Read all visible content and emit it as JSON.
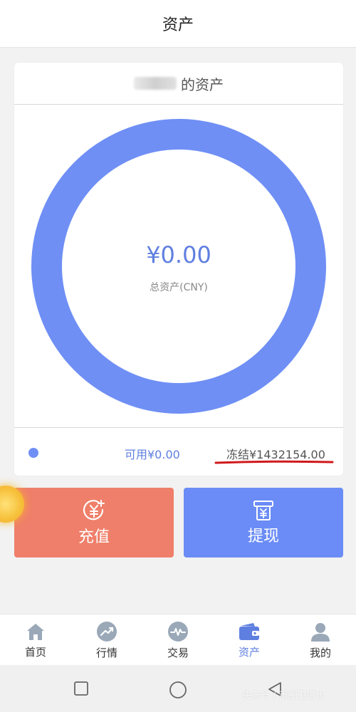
{
  "header": {
    "title": "资产"
  },
  "card": {
    "owner_suffix": "的资产",
    "total_amount": "¥0.00",
    "total_label": "总资产(CNY)",
    "available": "可用¥0.00",
    "frozen": "冻结¥1432154.00"
  },
  "actions": {
    "recharge_label": "充值",
    "withdraw_label": "提现"
  },
  "tabbar": {
    "items": [
      {
        "label": "首页",
        "icon": "home-icon"
      },
      {
        "label": "行情",
        "icon": "trend-icon"
      },
      {
        "label": "交易",
        "icon": "trade-icon"
      },
      {
        "label": "资产",
        "icon": "wallet-icon",
        "active": true
      },
      {
        "label": "我的",
        "icon": "user-icon"
      }
    ]
  },
  "system_nav": {
    "icons": [
      "recent-apps-icon",
      "home-circle-icon",
      "back-icon"
    ]
  },
  "watermark": "头条号 / 币圈卫道士",
  "colors": {
    "accent": "#6f8ff5",
    "recharge": "#ef7f6a",
    "withdraw": "#6b8cf6",
    "underline": "#d0191b"
  }
}
